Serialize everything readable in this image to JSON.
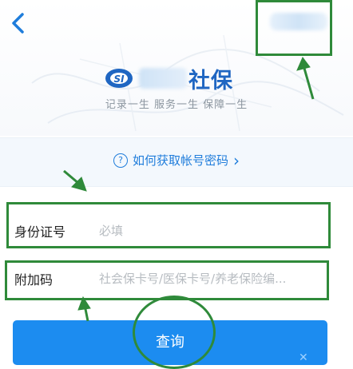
{
  "header": {
    "back_icon": "chevron-left-icon",
    "app_name": "社保",
    "slogan": "记录一生  服务一生  保障一生"
  },
  "help": {
    "icon": "question-circle-icon",
    "link_text": "如何获取帐号密码",
    "chevron": "›"
  },
  "form": {
    "id_label": "身份证号",
    "id_placeholder": "必填",
    "extra_label": "附加码",
    "extra_placeholder": "社会保卡号/医保卡号/养老保险编..."
  },
  "actions": {
    "query_label": "查询"
  },
  "colors": {
    "accent": "#1f7ddb",
    "button": "#1c8cf0",
    "annotation": "#2f8a3a"
  }
}
